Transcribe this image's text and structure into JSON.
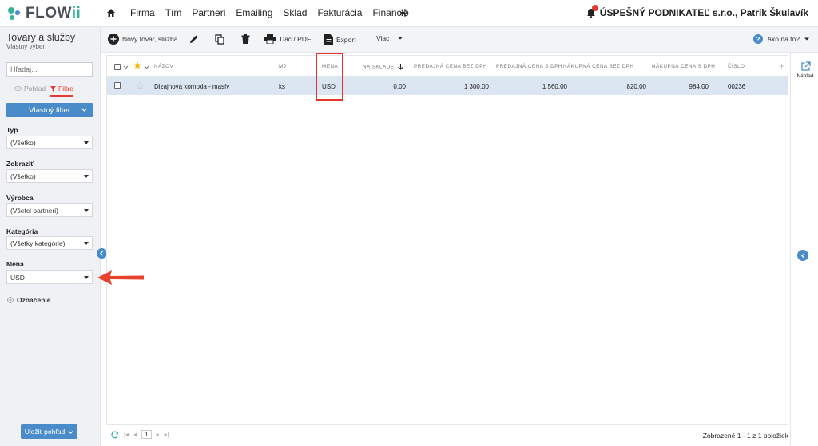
{
  "app": {
    "logo_prefix": "FLOW",
    "logo_suffix": "ii",
    "brand_color": "#37b39d",
    "accent_color": "#4a8cc9",
    "alert_color": "#e53b2c"
  },
  "nav": {
    "items": [
      "Firma",
      "Tím",
      "Partneri",
      "Emailing",
      "Sklad",
      "Fakturácia",
      "Financie"
    ],
    "company": "ÚSPEŠNÝ PODNIKATEĽ s.r.o., Patrik Škulavík"
  },
  "sidebar": {
    "title": "Tovary a služby",
    "subtitle": "Vlastný výber",
    "search_placeholder": "Hľadaj...",
    "tab_view": "Pohľad",
    "tab_filters": "Filtre",
    "custom_filter": "Vlastný filter",
    "filters": [
      {
        "label": "Typ",
        "value": "(Všetko)"
      },
      {
        "label": "Zobraziť",
        "value": "(Všetko)"
      },
      {
        "label": "Výrobca",
        "value": "(Všetci partneri)"
      },
      {
        "label": "Kategória",
        "value": "(Všetky kategórie)"
      },
      {
        "label": "Mena",
        "value": "USD"
      }
    ],
    "tagging": "Označenie",
    "save_view": "Uložiť pohľad"
  },
  "toolbar": {
    "new_item": "Nový tovar, služba",
    "print": "Tlač / PDF",
    "export": "Export",
    "more": "Viac",
    "help": "Ako na to?"
  },
  "grid": {
    "columns": [
      "NÁZOV",
      "MJ",
      "MENA",
      "NA SKLADE",
      "PREDAJNÁ CENA BEZ DPH",
      "PREDAJNÁ CENA S DPH",
      "NÁKUPNÁ CENA BEZ DPH",
      "NÁKUPNÁ CENA S DPH",
      "ČÍSLO"
    ],
    "rows": [
      {
        "name": "Dizajnová komoda - masív",
        "unit": "ks",
        "currency": "USD",
        "stock": "0,00",
        "sale_net": "1 300,00",
        "sale_gross": "1 560,00",
        "purchase_net": "820,00",
        "purchase_gross": "984,00",
        "number": "00236"
      }
    ],
    "page": "1",
    "count_text": "Zobrazené 1 - 1 z 1 položiek"
  },
  "right_panel": {
    "preview": "Náhľad"
  }
}
